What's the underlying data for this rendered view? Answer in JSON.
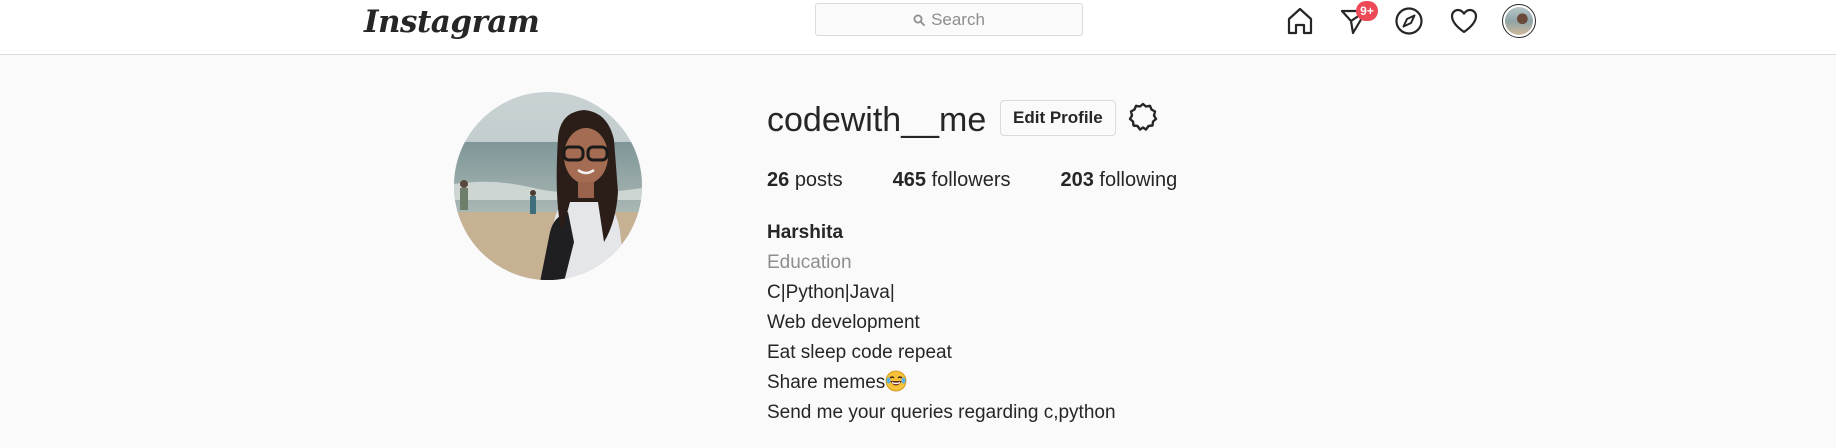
{
  "header": {
    "logo": "Instagram",
    "search": {
      "placeholder": "Search"
    },
    "nav": {
      "home": "home-icon",
      "direct": "paper-plane-icon",
      "direct_badge": "9+",
      "explore": "compass-icon",
      "activity": "heart-icon",
      "profile": "avatar"
    }
  },
  "profile": {
    "username": "codewith__me",
    "edit_label": "Edit Profile",
    "stats": {
      "posts_count": "26",
      "posts_label": "posts",
      "followers_count": "465",
      "followers_label": "followers",
      "following_count": "203",
      "following_label": "following"
    },
    "bio": {
      "name": "Harshita",
      "category": "Education",
      "lines": [
        "C|Python|Java|",
        "Web development",
        "Eat sleep code repeat",
        "Share memes",
        "Send me your queries regarding c,python"
      ]
    }
  },
  "colors": {
    "badge": "#ed4956",
    "background": "#fafafa",
    "border": "#dbdbdb",
    "muted": "#8e8e8e",
    "text": "#262626"
  }
}
